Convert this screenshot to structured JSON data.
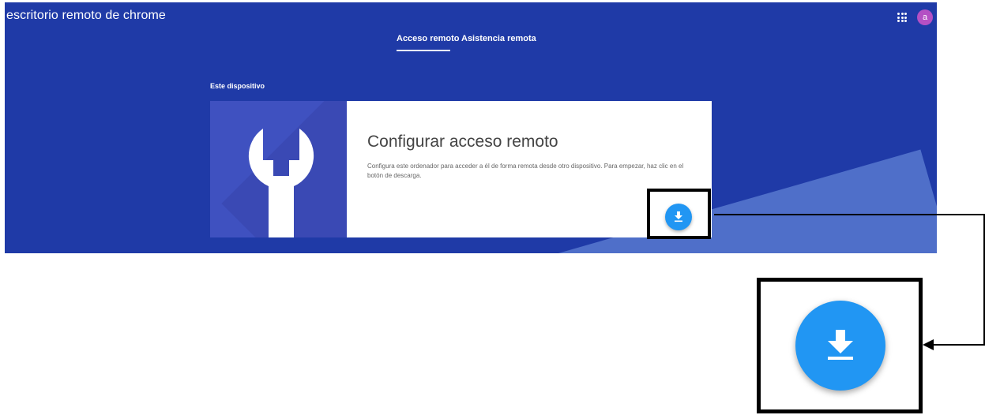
{
  "app": {
    "title": "escritorio remoto de chrome",
    "avatar_letter": "a"
  },
  "tabs": [
    {
      "label": "Acceso remoto",
      "active": true
    },
    {
      "label": "Asistencia remota",
      "active": false
    }
  ],
  "section": {
    "label": "Este dispositivo"
  },
  "card": {
    "title": "Configurar acceso remoto",
    "description": "Configura este ordenador para acceder a él de forma remota desde otro dispositivo. Para empezar, haz clic en el botón de descarga.",
    "icon": "wrench-icon",
    "action_icon": "download-icon"
  },
  "colors": {
    "header_bg": "#1f3aa7",
    "card_left_bg": "#3f51c0",
    "download_button": "#2196f3",
    "avatar": "#b450c4"
  }
}
